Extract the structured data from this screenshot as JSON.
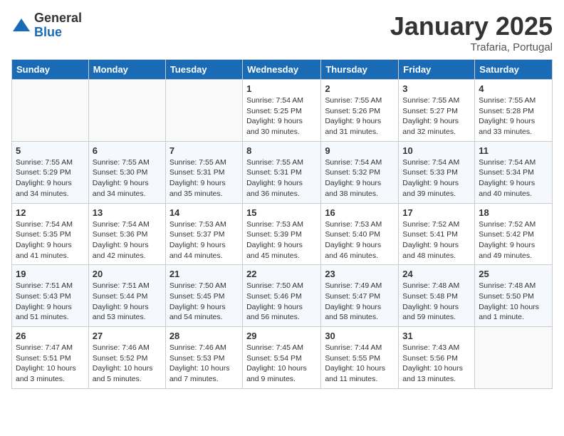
{
  "logo": {
    "general": "General",
    "blue": "Blue"
  },
  "header": {
    "month": "January 2025",
    "location": "Trafaria, Portugal"
  },
  "weekdays": [
    "Sunday",
    "Monday",
    "Tuesday",
    "Wednesday",
    "Thursday",
    "Friday",
    "Saturday"
  ],
  "weeks": [
    [
      {
        "day": "",
        "info": ""
      },
      {
        "day": "",
        "info": ""
      },
      {
        "day": "",
        "info": ""
      },
      {
        "day": "1",
        "info": "Sunrise: 7:54 AM\nSunset: 5:25 PM\nDaylight: 9 hours\nand 30 minutes."
      },
      {
        "day": "2",
        "info": "Sunrise: 7:55 AM\nSunset: 5:26 PM\nDaylight: 9 hours\nand 31 minutes."
      },
      {
        "day": "3",
        "info": "Sunrise: 7:55 AM\nSunset: 5:27 PM\nDaylight: 9 hours\nand 32 minutes."
      },
      {
        "day": "4",
        "info": "Sunrise: 7:55 AM\nSunset: 5:28 PM\nDaylight: 9 hours\nand 33 minutes."
      }
    ],
    [
      {
        "day": "5",
        "info": "Sunrise: 7:55 AM\nSunset: 5:29 PM\nDaylight: 9 hours\nand 34 minutes."
      },
      {
        "day": "6",
        "info": "Sunrise: 7:55 AM\nSunset: 5:30 PM\nDaylight: 9 hours\nand 34 minutes."
      },
      {
        "day": "7",
        "info": "Sunrise: 7:55 AM\nSunset: 5:31 PM\nDaylight: 9 hours\nand 35 minutes."
      },
      {
        "day": "8",
        "info": "Sunrise: 7:55 AM\nSunset: 5:31 PM\nDaylight: 9 hours\nand 36 minutes."
      },
      {
        "day": "9",
        "info": "Sunrise: 7:54 AM\nSunset: 5:32 PM\nDaylight: 9 hours\nand 38 minutes."
      },
      {
        "day": "10",
        "info": "Sunrise: 7:54 AM\nSunset: 5:33 PM\nDaylight: 9 hours\nand 39 minutes."
      },
      {
        "day": "11",
        "info": "Sunrise: 7:54 AM\nSunset: 5:34 PM\nDaylight: 9 hours\nand 40 minutes."
      }
    ],
    [
      {
        "day": "12",
        "info": "Sunrise: 7:54 AM\nSunset: 5:35 PM\nDaylight: 9 hours\nand 41 minutes."
      },
      {
        "day": "13",
        "info": "Sunrise: 7:54 AM\nSunset: 5:36 PM\nDaylight: 9 hours\nand 42 minutes."
      },
      {
        "day": "14",
        "info": "Sunrise: 7:53 AM\nSunset: 5:37 PM\nDaylight: 9 hours\nand 44 minutes."
      },
      {
        "day": "15",
        "info": "Sunrise: 7:53 AM\nSunset: 5:39 PM\nDaylight: 9 hours\nand 45 minutes."
      },
      {
        "day": "16",
        "info": "Sunrise: 7:53 AM\nSunset: 5:40 PM\nDaylight: 9 hours\nand 46 minutes."
      },
      {
        "day": "17",
        "info": "Sunrise: 7:52 AM\nSunset: 5:41 PM\nDaylight: 9 hours\nand 48 minutes."
      },
      {
        "day": "18",
        "info": "Sunrise: 7:52 AM\nSunset: 5:42 PM\nDaylight: 9 hours\nand 49 minutes."
      }
    ],
    [
      {
        "day": "19",
        "info": "Sunrise: 7:51 AM\nSunset: 5:43 PM\nDaylight: 9 hours\nand 51 minutes."
      },
      {
        "day": "20",
        "info": "Sunrise: 7:51 AM\nSunset: 5:44 PM\nDaylight: 9 hours\nand 53 minutes."
      },
      {
        "day": "21",
        "info": "Sunrise: 7:50 AM\nSunset: 5:45 PM\nDaylight: 9 hours\nand 54 minutes."
      },
      {
        "day": "22",
        "info": "Sunrise: 7:50 AM\nSunset: 5:46 PM\nDaylight: 9 hours\nand 56 minutes."
      },
      {
        "day": "23",
        "info": "Sunrise: 7:49 AM\nSunset: 5:47 PM\nDaylight: 9 hours\nand 58 minutes."
      },
      {
        "day": "24",
        "info": "Sunrise: 7:48 AM\nSunset: 5:48 PM\nDaylight: 9 hours\nand 59 minutes."
      },
      {
        "day": "25",
        "info": "Sunrise: 7:48 AM\nSunset: 5:50 PM\nDaylight: 10 hours\nand 1 minute."
      }
    ],
    [
      {
        "day": "26",
        "info": "Sunrise: 7:47 AM\nSunset: 5:51 PM\nDaylight: 10 hours\nand 3 minutes."
      },
      {
        "day": "27",
        "info": "Sunrise: 7:46 AM\nSunset: 5:52 PM\nDaylight: 10 hours\nand 5 minutes."
      },
      {
        "day": "28",
        "info": "Sunrise: 7:46 AM\nSunset: 5:53 PM\nDaylight: 10 hours\nand 7 minutes."
      },
      {
        "day": "29",
        "info": "Sunrise: 7:45 AM\nSunset: 5:54 PM\nDaylight: 10 hours\nand 9 minutes."
      },
      {
        "day": "30",
        "info": "Sunrise: 7:44 AM\nSunset: 5:55 PM\nDaylight: 10 hours\nand 11 minutes."
      },
      {
        "day": "31",
        "info": "Sunrise: 7:43 AM\nSunset: 5:56 PM\nDaylight: 10 hours\nand 13 minutes."
      },
      {
        "day": "",
        "info": ""
      }
    ]
  ]
}
